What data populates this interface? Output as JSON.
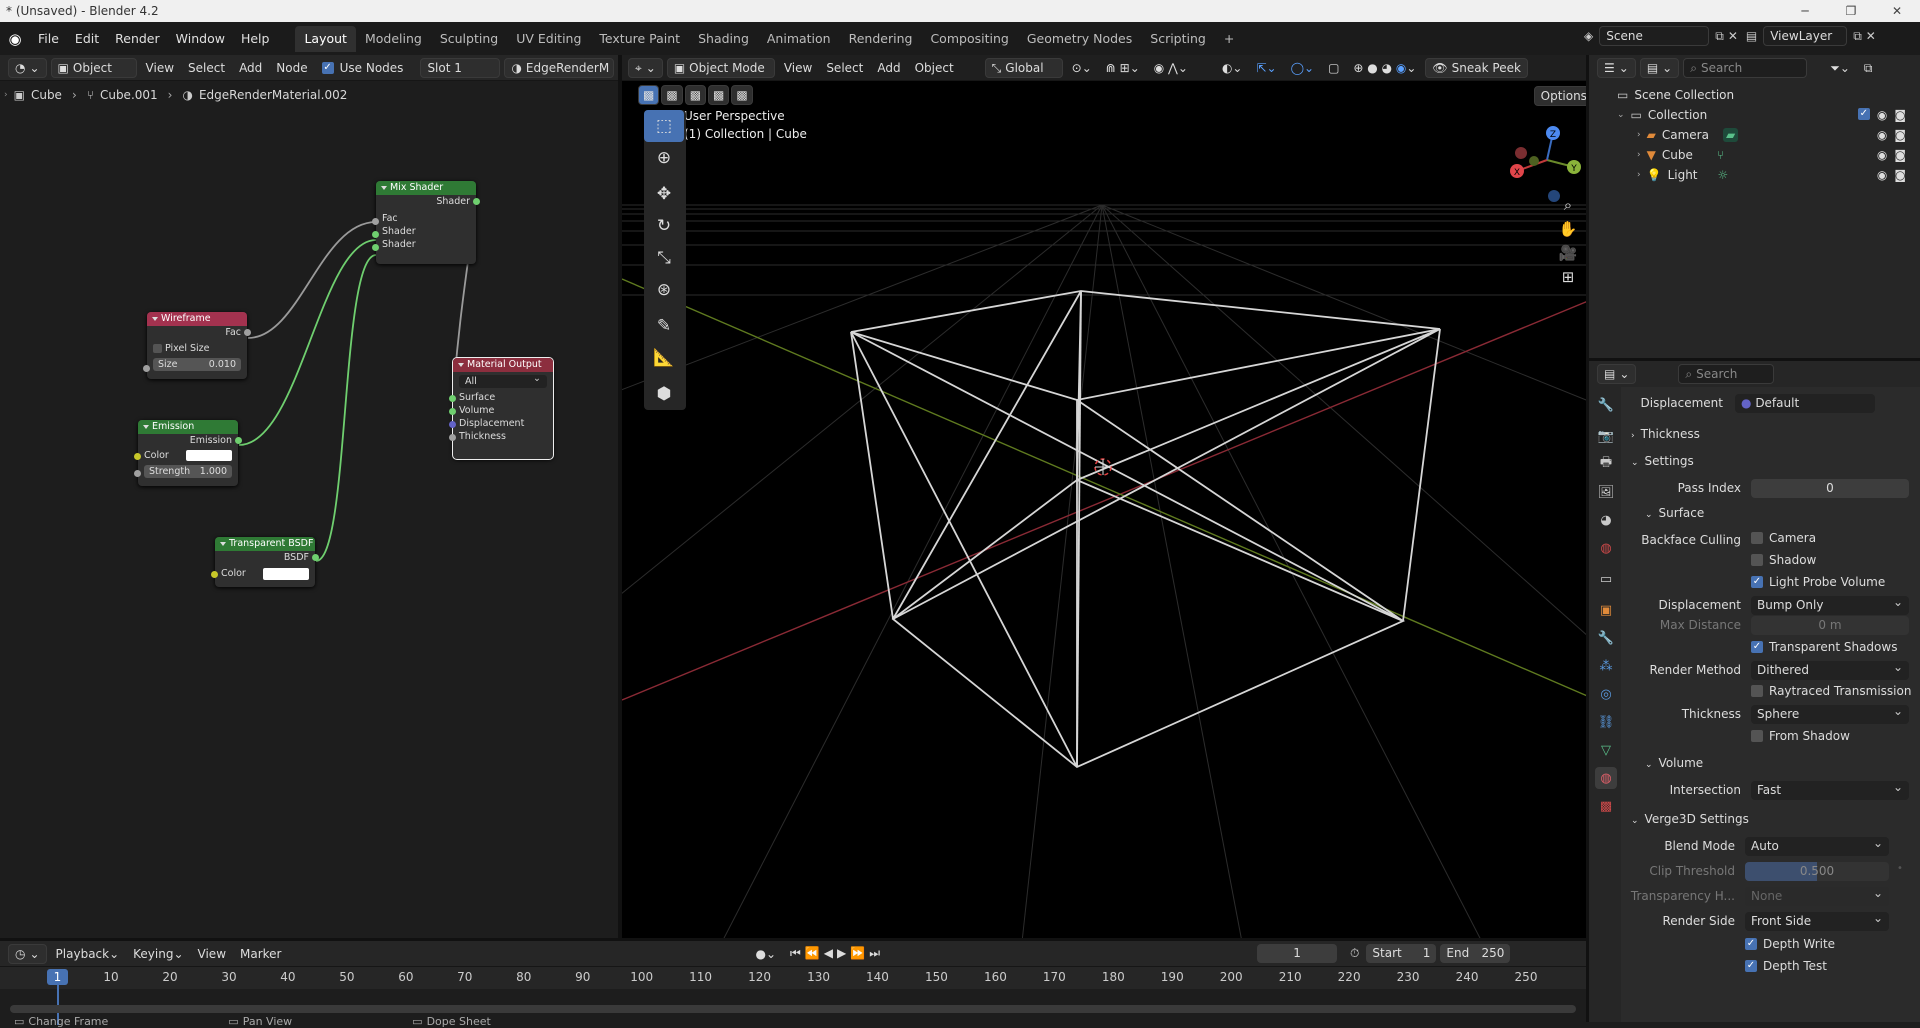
{
  "window": {
    "title": "* (Unsaved) - Blender 4.2",
    "min": "─",
    "max": "❐",
    "close": "✕"
  },
  "menu": [
    "File",
    "Edit",
    "Render",
    "Window",
    "Help"
  ],
  "workspaces": [
    "Layout",
    "Modeling",
    "Sculpting",
    "UV Editing",
    "Texture Paint",
    "Shading",
    "Animation",
    "Rendering",
    "Compositing",
    "Geometry Nodes",
    "Scripting"
  ],
  "workspace_add": "+",
  "scene": {
    "label": "Scene",
    "viewlayer": "ViewLayer"
  },
  "node_editor": {
    "header": {
      "object_type": "Object",
      "view": "View",
      "select": "Select",
      "add": "Add",
      "node": "Node",
      "use_nodes": "Use Nodes",
      "slot": "Slot 1",
      "material": "EdgeRenderM"
    },
    "breadcrumb": {
      "object": "Cube",
      "mesh": "Cube.001",
      "material": "EdgeRenderMaterial.002"
    },
    "nodes": {
      "mix_shader": {
        "title": "Mix Shader",
        "out": "Shader",
        "in": [
          "Fac",
          "Shader",
          "Shader"
        ]
      },
      "wireframe": {
        "title": "Wireframe",
        "out": "Fac",
        "pixel_size": "Pixel Size",
        "size_label": "Size",
        "size_value": "0.010"
      },
      "emission": {
        "title": "Emission",
        "out": "Emission",
        "color": "Color",
        "strength_label": "Strength",
        "strength_value": "1.000"
      },
      "transparent": {
        "title": "Transparent BSDF",
        "out": "BSDF",
        "color": "Color"
      },
      "output": {
        "title": "Material Output",
        "target": "All",
        "in": [
          "Surface",
          "Volume",
          "Displacement",
          "Thickness"
        ]
      }
    }
  },
  "viewport": {
    "header": {
      "mode": "Object Mode",
      "view": "View",
      "select": "Select",
      "add": "Add",
      "object": "Object",
      "orientation": "Global",
      "sneak_peek": "Sneak Peek",
      "options": "Options"
    },
    "overlay_title": "User Perspective",
    "overlay_sub": "(1) Collection | Cube",
    "axes": {
      "x": "X",
      "y": "Y",
      "z": "Z"
    }
  },
  "outliner": {
    "search_placeholder": "Search",
    "root": "Scene Collection",
    "collection": "Collection",
    "items": [
      "Camera",
      "Cube",
      "Light"
    ]
  },
  "properties": {
    "search_placeholder": "Search",
    "displacement_top_label": "Displacement",
    "displacement_top_value": "Default",
    "thickness_panel": "Thickness",
    "settings_panel": "Settings",
    "pass_index_label": "Pass Index",
    "pass_index_value": "0",
    "surface_panel": "Surface",
    "backface_culling": "Backface Culling",
    "camera": "Camera",
    "shadow": "Shadow",
    "light_probe_volume": "Light Probe Volume",
    "displacement_label": "Displacement",
    "displacement_value": "Bump Only",
    "max_distance_label": "Max Distance",
    "max_distance_value": "0 m",
    "transparent_shadows": "Transparent Shadows",
    "render_method_label": "Render Method",
    "render_method_value": "Dithered",
    "raytraced_transmission": "Raytraced Transmission",
    "thickness_label": "Thickness",
    "thickness_value": "Sphere",
    "from_shadow": "From Shadow",
    "volume_panel": "Volume",
    "intersection_label": "Intersection",
    "intersection_value": "Fast",
    "verge_panel": "Verge3D Settings",
    "blend_mode_label": "Blend Mode",
    "blend_mode_value": "Auto",
    "clip_threshold_label": "Clip Threshold",
    "clip_threshold_value": "0.500",
    "transparency_label": "Transparency H...",
    "transparency_value": "None",
    "render_side_label": "Render Side",
    "render_side_value": "Front Side",
    "depth_write": "Depth Write",
    "depth_test": "Depth Test"
  },
  "timeline": {
    "playback": "Playback",
    "keying": "Keying",
    "view": "View",
    "marker": "Marker",
    "current_frame": "1",
    "start_label": "Start",
    "start_value": "1",
    "end_label": "End",
    "end_value": "250",
    "ticks": [
      "1",
      "10",
      "20",
      "30",
      "40",
      "50",
      "60",
      "70",
      "80",
      "90",
      "100",
      "110",
      "120",
      "130",
      "140",
      "150",
      "160",
      "170",
      "180",
      "190",
      "200",
      "210",
      "220",
      "230",
      "240",
      "250"
    ]
  },
  "statusbar": {
    "change_frame": "Change Frame",
    "pan_view": "Pan View",
    "dope_sheet": "Dope Sheet"
  }
}
